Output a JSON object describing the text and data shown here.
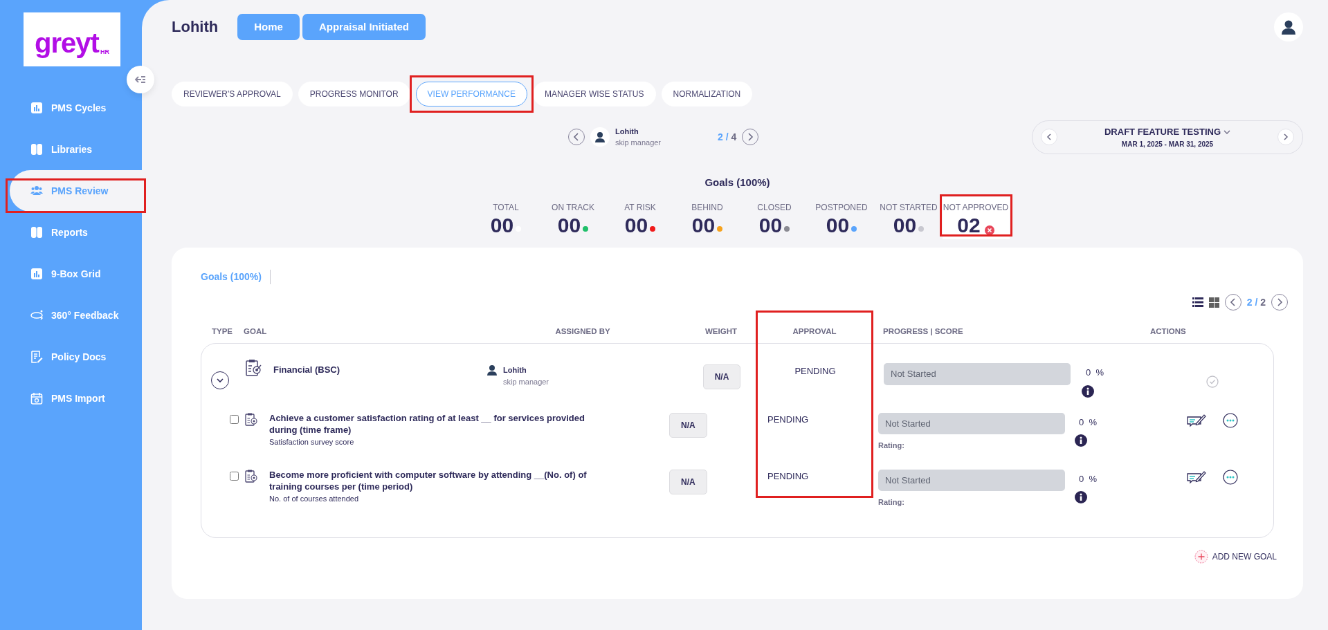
{
  "sidebar": {
    "logo": {
      "text": "greyt",
      "sub": "HR"
    },
    "items": [
      {
        "label": "PMS Cycles",
        "kind": "chart",
        "selected": false,
        "highlighted": false
      },
      {
        "label": "Libraries",
        "kind": "book",
        "selected": false,
        "highlighted": false
      },
      {
        "label": "PMS Review",
        "kind": "people",
        "selected": true,
        "highlighted": true
      },
      {
        "label": "Reports",
        "kind": "book",
        "selected": false,
        "highlighted": false
      },
      {
        "label": "9-Box Grid",
        "kind": "chart",
        "selected": false,
        "highlighted": false
      },
      {
        "label": "360° Feedback",
        "kind": "cycle",
        "selected": false,
        "highlighted": false
      },
      {
        "label": "Policy Docs",
        "kind": "doc",
        "selected": false,
        "highlighted": false
      },
      {
        "label": "PMS Import",
        "kind": "calendar",
        "selected": false,
        "highlighted": false
      }
    ]
  },
  "header": {
    "title": "Lohith",
    "buttons": [
      "Home",
      "Appraisal Initiated"
    ]
  },
  "tabs": [
    {
      "label": "REVIEWER'S APPROVAL",
      "selected": false,
      "highlighted": false
    },
    {
      "label": "PROGRESS MONITOR",
      "selected": false,
      "highlighted": false
    },
    {
      "label": "VIEW PERFORMANCE",
      "selected": true,
      "highlighted": true
    },
    {
      "label": "MANAGER WISE STATUS",
      "selected": false,
      "highlighted": false
    },
    {
      "label": "NORMALIZATION",
      "selected": false,
      "highlighted": false
    }
  ],
  "employee_nav": {
    "name": "Lohith",
    "role": "skip manager",
    "current": "2",
    "separator": "/",
    "total": "4"
  },
  "cycle": {
    "name": "DRAFT FEATURE TESTING",
    "dates": "MAR 1, 2025 - MAR 31, 2025"
  },
  "summary": {
    "title": "Goals (100%)",
    "stats": [
      {
        "label": "TOTAL",
        "value": "00",
        "kind": "dot",
        "color": "#ffffff",
        "highlighted": false
      },
      {
        "label": "ON TRACK",
        "value": "00",
        "kind": "dot",
        "color": "#1fbf6a",
        "highlighted": false
      },
      {
        "label": "AT RISK",
        "value": "00",
        "kind": "dot",
        "color": "#f01a1a",
        "highlighted": false
      },
      {
        "label": "BEHIND",
        "value": "00",
        "kind": "dot",
        "color": "#f6a21d",
        "highlighted": false
      },
      {
        "label": "CLOSED",
        "value": "00",
        "kind": "dot",
        "color": "#8a8a92",
        "highlighted": false
      },
      {
        "label": "POSTPONED",
        "value": "00",
        "kind": "dot",
        "color": "#5aa4fc",
        "highlighted": false
      },
      {
        "label": "NOT STARTED",
        "value": "00",
        "kind": "dot",
        "color": "#c8c8d0",
        "highlighted": false
      },
      {
        "label": "NOT APPROVED",
        "value": "02",
        "kind": "error",
        "color": "#e8475a",
        "highlighted": true
      }
    ]
  },
  "goals_panel": {
    "tab": "Goals (100%)",
    "pager": {
      "current": "2",
      "separator": "/",
      "total": "2"
    },
    "columns": [
      {
        "label": "TYPE",
        "highlighted": false
      },
      {
        "label": "GOAL",
        "highlighted": false
      },
      {
        "label": "ASSIGNED BY",
        "highlighted": false
      },
      {
        "label": "WEIGHT",
        "highlighted": false
      },
      {
        "label": "APPROVAL",
        "highlighted": true
      },
      {
        "label": "PROGRESS | SCORE",
        "highlighted": false
      },
      {
        "label": "ACTIONS",
        "highlighted": false
      }
    ],
    "groups": [
      {
        "title": "Financial (BSC)",
        "expanded": true,
        "assigned_by": {
          "name": "Lohith",
          "role": "skip manager"
        },
        "weight": "N/A",
        "approval": "PENDING",
        "progress": "Not Started",
        "level": 0,
        "score": "0",
        "unit": "%",
        "goals": [
          {
            "title": "Achieve a customer satisfaction rating of at least __ for services provided during (time frame)",
            "metric": "Satisfaction survey score",
            "checked": false,
            "weight": "N/A",
            "approval": "PENDING",
            "progress": "Not Started",
            "level": 0,
            "rating_label": "Rating:",
            "score": "0",
            "unit": "%"
          },
          {
            "title": "Become more proficient with computer software by attending __(No. of) of training courses per (time period)",
            "metric": "No. of of courses attended",
            "checked": false,
            "weight": "N/A",
            "approval": "PENDING",
            "progress": "Not Started",
            "level": 0,
            "rating_label": "Rating:",
            "score": "0",
            "unit": "%"
          }
        ]
      }
    ],
    "add_button": "ADD NEW GOAL"
  }
}
